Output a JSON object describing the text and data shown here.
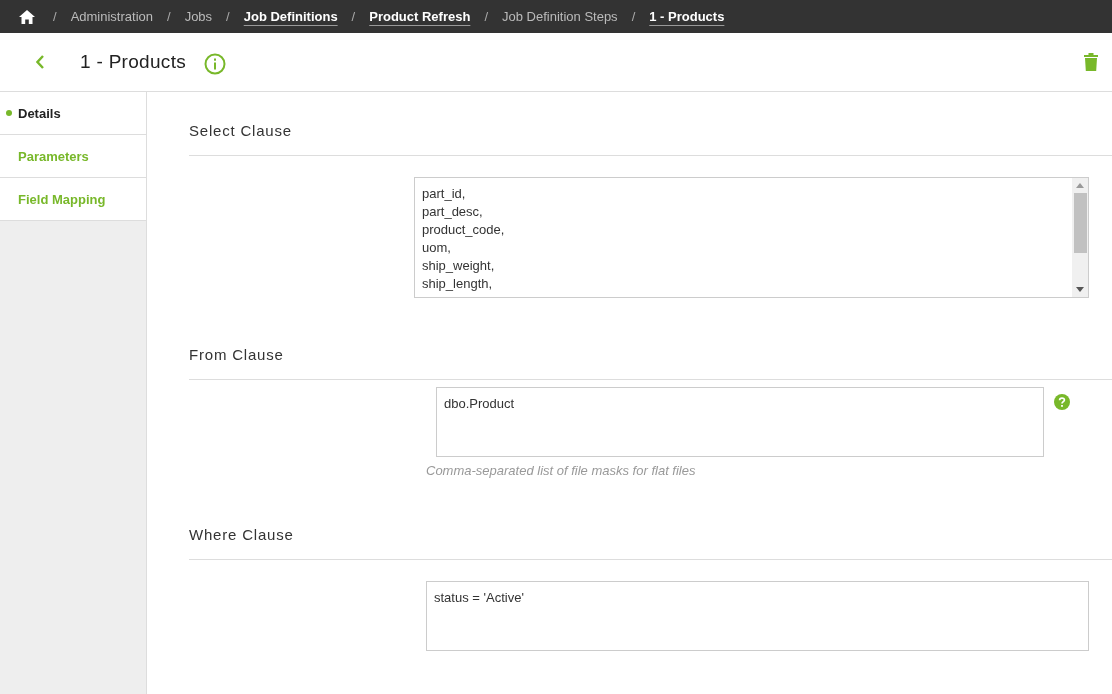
{
  "breadcrumbs": [
    {
      "label": "Administration",
      "linked": false
    },
    {
      "label": "Jobs",
      "linked": false
    },
    {
      "label": "Job Definitions",
      "linked": true
    },
    {
      "label": "Product Refresh",
      "linked": true
    },
    {
      "label": "Job Definition Steps",
      "linked": false
    },
    {
      "label": "1 - Products",
      "linked": true
    }
  ],
  "separator": "/",
  "header": {
    "title": "1 - Products"
  },
  "sidebar": {
    "items": [
      {
        "label": "Details",
        "selected": true
      },
      {
        "label": "Parameters",
        "selected": false
      },
      {
        "label": "Field Mapping",
        "selected": false
      }
    ]
  },
  "sections": [
    {
      "title": "Select Clause",
      "kind": "scrolling",
      "value": "part_id,\npart_desc,\nproduct_code,\nuom,\nship_weight,\nship_length,"
    },
    {
      "title": "From Clause",
      "kind": "help",
      "value": "dbo.Product",
      "hint": "Comma-separated list of file masks for flat files"
    },
    {
      "title": "Where Clause",
      "kind": "plain",
      "value": "status = 'Active'"
    }
  ]
}
